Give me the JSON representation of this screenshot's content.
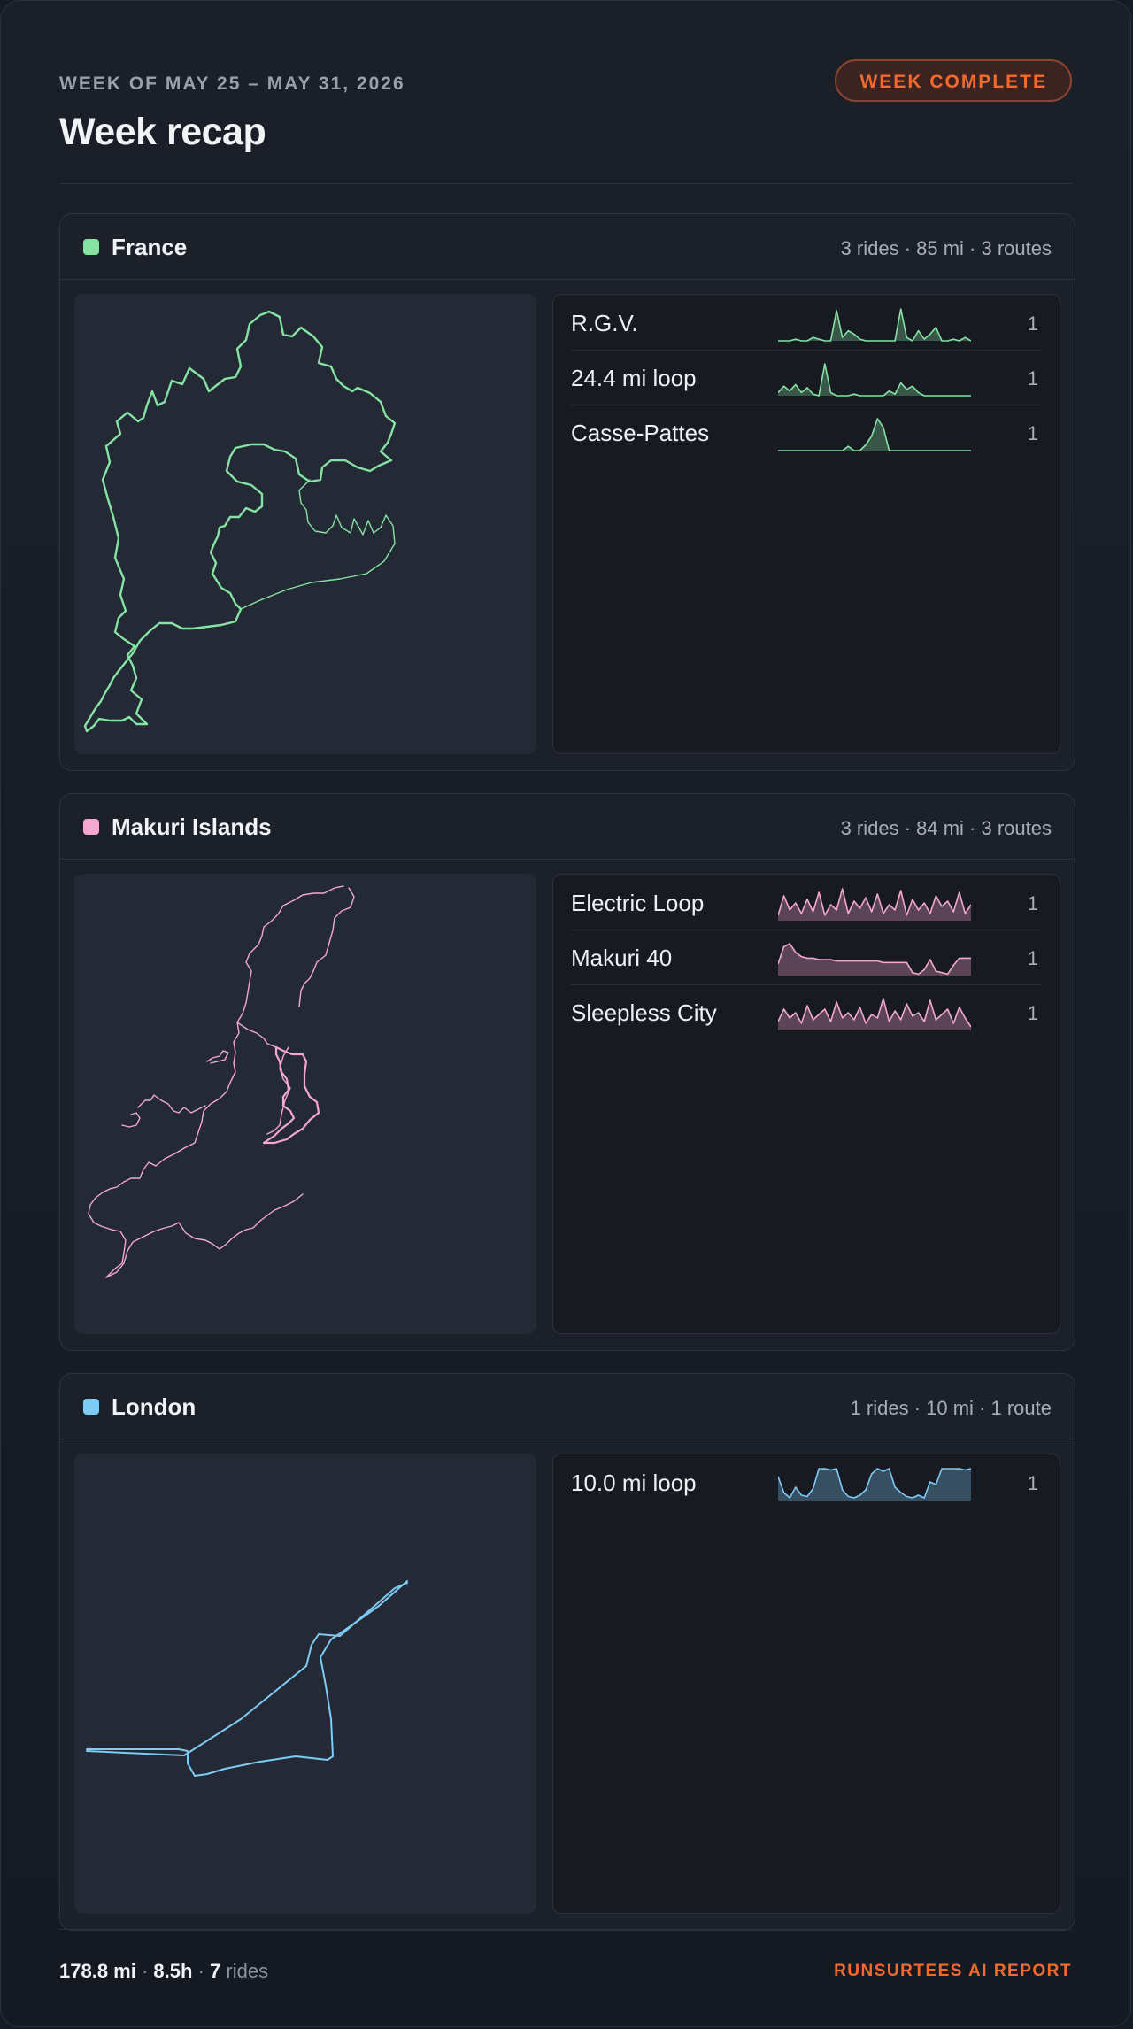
{
  "header": {
    "kicker": "WEEK OF MAY 25 – MAY 31, 2026",
    "title": "Week recap",
    "badge": "WEEK COMPLETE"
  },
  "regions": [
    {
      "name": "France",
      "color": "#86e3a3",
      "stats": "3 rides · 85 mi · 3 routes",
      "routes": [
        {
          "name": "R.G.V.",
          "count": "1",
          "elevation": [
            0,
            0,
            0,
            1,
            0,
            0,
            2,
            1,
            0,
            0,
            18,
            2,
            6,
            4,
            1,
            0,
            0,
            0,
            0,
            0,
            0,
            19,
            2,
            0,
            6,
            1,
            4,
            8,
            0,
            0,
            1,
            0,
            2,
            0
          ]
        },
        {
          "name": "24.4 mi loop",
          "count": "1",
          "elevation": [
            2,
            6,
            3,
            7,
            2,
            5,
            1,
            0,
            20,
            2,
            0,
            0,
            0,
            1,
            0,
            0,
            0,
            0,
            0,
            3,
            1,
            8,
            4,
            6,
            2,
            0,
            0,
            0,
            0,
            0,
            0,
            0,
            0,
            0
          ]
        },
        {
          "name": "Casse-Pattes",
          "count": "1",
          "elevation": [
            0,
            0,
            0,
            0,
            0,
            0,
            0,
            0,
            0,
            0,
            0,
            0,
            3,
            0,
            0,
            4,
            10,
            22,
            16,
            0,
            0,
            0,
            0,
            0,
            0,
            0,
            0,
            0,
            0,
            0,
            0,
            0,
            0,
            0
          ]
        }
      ]
    },
    {
      "name": "Makuri Islands",
      "color": "#f4a7cf",
      "stats": "3 rides · 84 mi · 3 routes",
      "routes": [
        {
          "name": "Electric Loop",
          "count": "1",
          "elevation": [
            3,
            14,
            6,
            10,
            4,
            12,
            5,
            16,
            3,
            9,
            6,
            18,
            4,
            11,
            7,
            13,
            5,
            15,
            4,
            9,
            6,
            17,
            3,
            12,
            6,
            10,
            4,
            14,
            8,
            11,
            5,
            16,
            4,
            9
          ]
        },
        {
          "name": "Makuri 40",
          "count": "1",
          "elevation": [
            8,
            20,
            22,
            16,
            13,
            12,
            12,
            11,
            11,
            11,
            10,
            10,
            10,
            10,
            10,
            10,
            10,
            10,
            9,
            9,
            9,
            9,
            9,
            2,
            1,
            4,
            11,
            3,
            2,
            1,
            7,
            12,
            12,
            12
          ]
        },
        {
          "name": "Sleepless City",
          "count": "1",
          "elevation": [
            5,
            12,
            7,
            10,
            4,
            14,
            6,
            9,
            12,
            5,
            16,
            7,
            10,
            6,
            13,
            4,
            9,
            7,
            18,
            5,
            11,
            6,
            15,
            8,
            10,
            5,
            17,
            6,
            9,
            12,
            4,
            13,
            7,
            2
          ]
        }
      ]
    },
    {
      "name": "London",
      "color": "#7ecbf4",
      "stats": "1 rides · 10 mi · 1 route",
      "routes": [
        {
          "name": "10.0 mi loop",
          "count": "1",
          "elevation": [
            18,
            6,
            2,
            10,
            4,
            3,
            9,
            24,
            24,
            23,
            24,
            8,
            3,
            2,
            4,
            8,
            20,
            24,
            22,
            24,
            10,
            6,
            3,
            2,
            4,
            2,
            14,
            12,
            24,
            24,
            24,
            24,
            23,
            24
          ]
        }
      ]
    }
  ],
  "footer": {
    "distance": "178.8 mi",
    "sep1": "·",
    "hours": "8.5h",
    "sep2": "·",
    "rides_count": "7",
    "rides_label": "rides",
    "brand": "RUNSURTEES AI REPORT"
  }
}
